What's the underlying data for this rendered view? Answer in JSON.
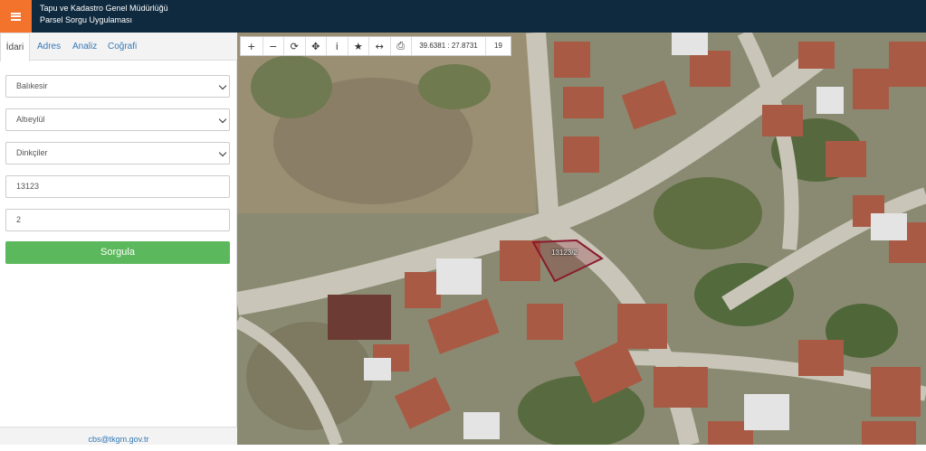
{
  "header": {
    "title": "Tapu ve Kadastro Genel Müdürlüğü",
    "subtitle": "Parsel Sorgu Uygulaması",
    "menu_icon": "hamburger-icon",
    "accent": "#f3722c",
    "bar_color": "#0f2a3f"
  },
  "tabs": [
    {
      "label": "İdari",
      "active": true
    },
    {
      "label": "Adres",
      "active": false
    },
    {
      "label": "Analiz",
      "active": false
    },
    {
      "label": "Coğrafi",
      "active": false
    }
  ],
  "form": {
    "province": "Balıkesir",
    "district": "Altıeylül",
    "neighborhood": "Dinkçiler",
    "block": "13123",
    "parcel": "2",
    "submit_label": "Sorgula",
    "submit_color": "#5cb85c"
  },
  "footer": {
    "email": "cbs@tkgm.gov.tr"
  },
  "map": {
    "coordinates": "39.6381 : 27.8731",
    "zoom": "19",
    "parcel_label": "13123/2",
    "parcel_color": "#8b1a2b",
    "tools": [
      "zoom-in-icon",
      "zoom-out-icon",
      "refresh-icon",
      "pan-icon",
      "info-icon",
      "favorite-icon",
      "measure-icon",
      "print-icon"
    ]
  }
}
